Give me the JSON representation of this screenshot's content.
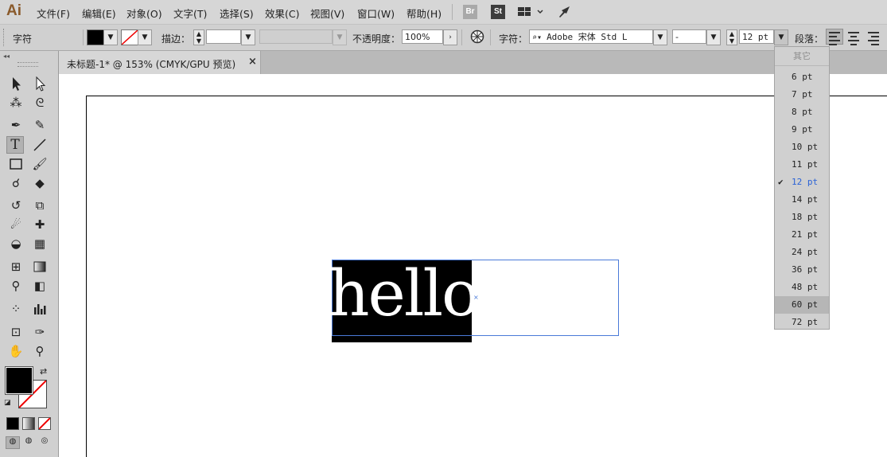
{
  "app": {
    "logo": "Ai"
  },
  "menu": [
    "文件(F)",
    "编辑(E)",
    "对象(O)",
    "文字(T)",
    "选择(S)",
    "效果(C)",
    "视图(V)",
    "窗口(W)",
    "帮助(H)"
  ],
  "app_icons": {
    "bridge": "Br",
    "stock": "St"
  },
  "controlbar": {
    "panel_label": "字符",
    "stroke_label": "描边：",
    "stroke_value": "",
    "opacity_label": "不透明度：",
    "opacity_value": "100%",
    "font_label": "字符：",
    "font_name": "Adobe 宋体 Std L",
    "font_style": "-",
    "font_size": "12 pt",
    "paragraph_label": "段落："
  },
  "document": {
    "tab_title": "未标题-1* @ 153% (CMYK/GPU 预览)",
    "close_glyph": "×"
  },
  "canvas": {
    "text": "hello"
  },
  "size_dropdown": {
    "other_label": "其它",
    "options": [
      "6 pt",
      "7 pt",
      "8 pt",
      "9 pt",
      "10 pt",
      "11 pt",
      "12 pt",
      "14 pt",
      "18 pt",
      "21 pt",
      "24 pt",
      "36 pt",
      "48 pt",
      "60 pt",
      "72 pt"
    ],
    "selected": "12 pt",
    "hovered": "60 pt"
  },
  "colors": {
    "fill": "#000000",
    "stroke": "none",
    "accent": "#2a62d6",
    "selection_frame": "#4a7ad8"
  },
  "tools": [
    "selection-tool-icon",
    "direct-selection-tool-icon",
    "magic-wand-tool-icon",
    "lasso-tool-icon",
    "pen-tool-icon",
    "curvature-tool-icon",
    "type-tool-icon",
    "line-tool-icon",
    "rectangle-tool-icon",
    "paintbrush-tool-icon",
    "shaper-tool-icon",
    "eraser-tool-icon",
    "rotate-tool-icon",
    "scale-tool-icon",
    "warp-tool-icon",
    "free-transform-tool-icon",
    "shape-builder-tool-icon",
    "perspective-grid-tool-icon",
    "mesh-tool-icon",
    "gradient-tool-icon",
    "eyedropper-tool-icon",
    "blend-tool-icon",
    "symbol-sprayer-tool-icon",
    "graph-tool-icon",
    "artboard-tool-icon",
    "slice-tool-icon",
    "hand-tool-icon",
    "zoom-tool-icon"
  ]
}
